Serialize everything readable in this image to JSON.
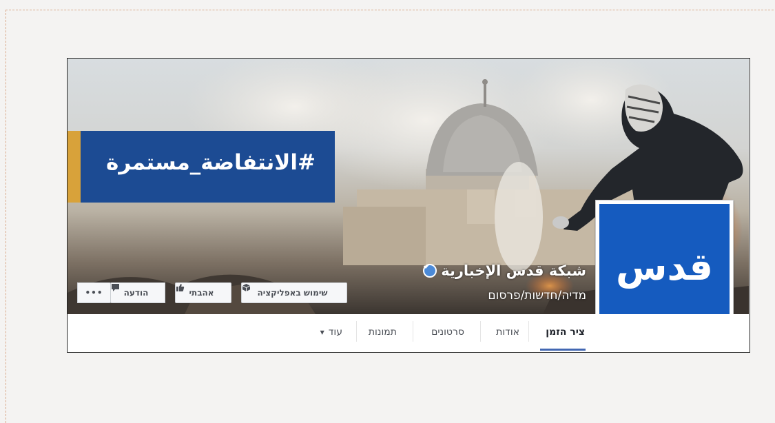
{
  "hashtag": "#الانتفاضة_مستمرة",
  "page": {
    "name": "شبكة قدس الإخبارية",
    "category": "מדיה/חדשות/פרסום",
    "logo": "قدس",
    "verified_icon": "verified-check-icon"
  },
  "actions": {
    "use_app": "שימוש באפליקציה",
    "like": "אהבתי",
    "message": "הודעה",
    "more": "•••"
  },
  "tabs": [
    {
      "label": "ציר הזמן",
      "active": true
    },
    {
      "label": "אודות"
    },
    {
      "label": "סרטונים"
    },
    {
      "label": "תמונות"
    },
    {
      "label": "עוד"
    }
  ],
  "colors": {
    "banner": "#1c4b93",
    "banner_accent": "#d8a23a",
    "logo_bg": "#155bbf",
    "tab_active_underline": "#4267b2"
  }
}
